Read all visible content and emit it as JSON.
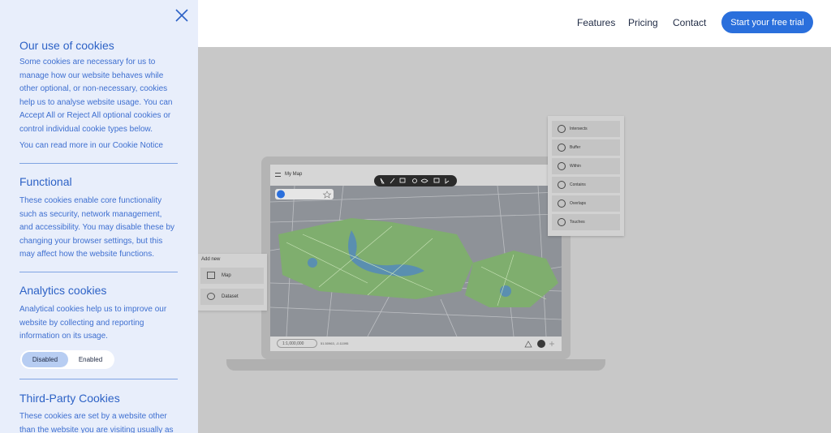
{
  "header": {
    "nav": [
      "Features",
      "Pricing",
      "Contact"
    ],
    "cta": "Start your free trial"
  },
  "app": {
    "title": "My Map",
    "scale": "1:1,000,000",
    "coords": "51.50963, -0.11095"
  },
  "add_panel": {
    "title": "Add new",
    "items": [
      "Map",
      "Dataset"
    ]
  },
  "tool_panel": {
    "items": [
      "Intersects",
      "Buffer",
      "Within",
      "Contains",
      "Overlaps",
      "Touches"
    ]
  },
  "cookies": {
    "title": "Our use of cookies",
    "intro": "Some cookies are necessary for us to manage how our website behaves while other optional, or non-necessary, cookies help us to analyse website usage. You can Accept All or Reject All optional cookies or control individual cookie types below.",
    "notice": "You can read more in our Cookie Notice",
    "functional_title": "Functional",
    "functional_text": "These cookies enable core functionality such as security, network management, and accessibility. You may disable these by changing your browser settings, but this may affect how the website functions.",
    "analytics_title": "Analytics cookies",
    "analytics_text": "Analytical cookies help us to improve our website by collecting and reporting information on its usage.",
    "toggle_disabled": "Disabled",
    "toggle_enabled": "Enabled",
    "thirdparty_title": "Third-Party Cookies",
    "thirdparty_text": "These cookies are set by a website other than the website you are visiting usually as"
  },
  "colors": {
    "accent": "#2a6fdc",
    "sidebar_bg": "#e8eefb",
    "sidebar_text": "#3e6fd0",
    "map_green": "#7fae6e",
    "map_water": "#5a8fb0"
  }
}
